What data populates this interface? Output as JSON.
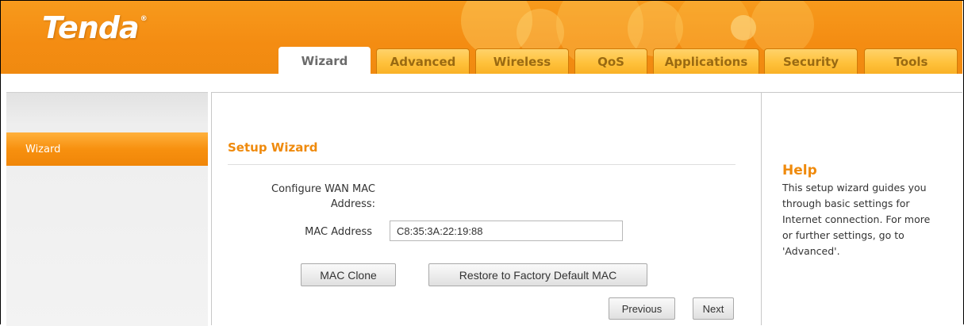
{
  "brand": {
    "logo_text": "Tenda",
    "registered_mark": "®"
  },
  "nav": {
    "tabs": [
      {
        "label": "Wizard",
        "active": true
      },
      {
        "label": "Advanced",
        "active": false
      },
      {
        "label": "Wireless",
        "active": false
      },
      {
        "label": "QoS",
        "active": false
      },
      {
        "label": "Applications",
        "active": false
      },
      {
        "label": "Security",
        "active": false
      },
      {
        "label": "Tools",
        "active": false
      }
    ]
  },
  "sidebar": {
    "items": [
      {
        "label": "Wizard",
        "active": true
      }
    ]
  },
  "main": {
    "title": "Setup Wizard",
    "configure_label": "Configure WAN MAC Address:",
    "mac_label": "MAC Address",
    "mac_value": "C8:35:3A:22:19:88",
    "mac_clone_button": "MAC Clone",
    "restore_button": "Restore to Factory Default MAC",
    "previous_button": "Previous",
    "next_button": "Next"
  },
  "help": {
    "title": "Help",
    "text": "This setup wizard guides you through basic settings for Internet connection. For more or further settings, go to 'Advanced'."
  },
  "colors": {
    "accent": "#ef8a0c",
    "header": "#f48c12",
    "tab": "#ffc23c",
    "tab_text": "#9a6a12"
  }
}
